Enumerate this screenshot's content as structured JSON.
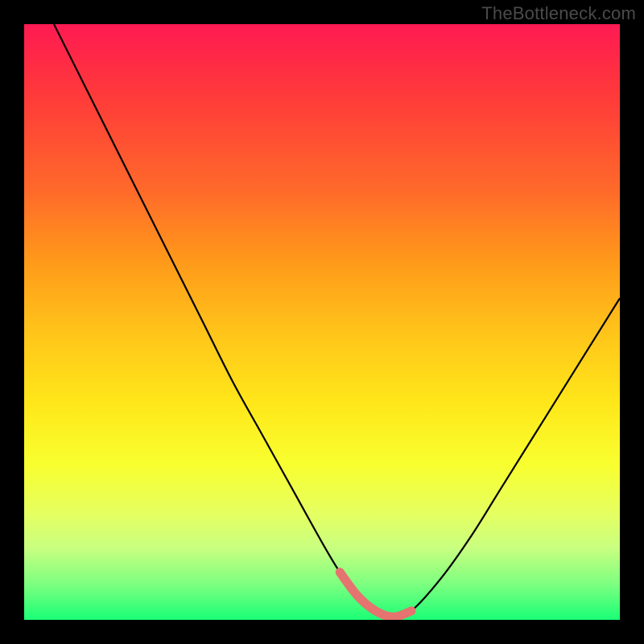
{
  "watermark": "TheBottleneck.com",
  "chart_data": {
    "type": "line",
    "title": "",
    "xlabel": "",
    "ylabel": "",
    "xlim": [
      0,
      100
    ],
    "ylim": [
      0,
      100
    ],
    "grid": false,
    "legend": false,
    "annotations": [],
    "background_gradient": {
      "top": "#ff1a52",
      "bottom": "#1aff76",
      "meaning": "red = high bottleneck, green = low bottleneck"
    },
    "series": [
      {
        "name": "bottleneck-curve",
        "color": "#000000",
        "x": [
          5,
          10,
          15,
          20,
          25,
          30,
          35,
          40,
          45,
          50,
          53,
          56,
          59,
          62,
          65,
          70,
          75,
          80,
          85,
          90,
          95,
          100
        ],
        "y": [
          100,
          90,
          80,
          70,
          60,
          50,
          40,
          31,
          22,
          13,
          8,
          4,
          1.5,
          0.5,
          1.5,
          7,
          14,
          22,
          30,
          38,
          46,
          54
        ]
      },
      {
        "name": "optimal-zone-highlight",
        "color": "#e5736f",
        "x": [
          53,
          56,
          59,
          62,
          65
        ],
        "y": [
          8,
          4,
          1.5,
          0.5,
          1.5
        ]
      }
    ],
    "optimal_x_range": [
      53,
      65
    ]
  }
}
